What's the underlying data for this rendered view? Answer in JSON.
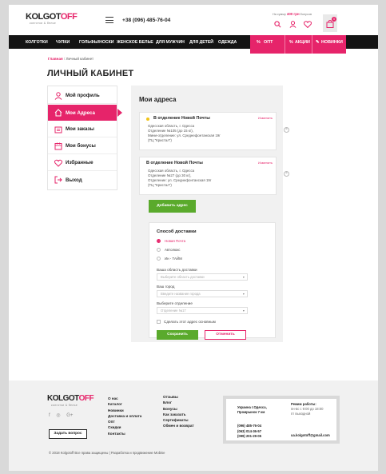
{
  "header": {
    "logo_part1": "KOLGOT",
    "logo_part2": "OFF",
    "logo_sub": "колготки & белье",
    "phone": "+38 (096) 485-76-04",
    "cart_prefix": "На сумму",
    "cart_amount": "400 грн",
    "cart_suffix": "бонусов",
    "cart_count": "0"
  },
  "nav": {
    "items": [
      "КОЛГОТКИ",
      "ЧУЛКИ",
      "ГОЛЬФЫ/НОСКИ",
      "ЖЕНСКОЕ БЕЛЬЕ",
      "ДЛЯ МУЖЧИН",
      "ДЛЯ ДЕТЕЙ",
      "ОДЕЖДА"
    ],
    "opt": "ОПТ",
    "sale": "АКЦИИ",
    "new": "НОВИНКИ"
  },
  "breadcrumb": {
    "home": "Главная",
    "sep": "/",
    "current": "Личный кабинет"
  },
  "page_title": "ЛИЧНЫЙ КАБИНЕТ",
  "sidebar": {
    "items": [
      {
        "label": "Мой профиль"
      },
      {
        "label": "Мои Адреса"
      },
      {
        "label": "Мои заказы"
      },
      {
        "label": "Мои бонусы"
      },
      {
        "label": "Избранные"
      },
      {
        "label": "Выход"
      }
    ]
  },
  "addresses": {
    "title": "Мои адреса",
    "cards": [
      {
        "title": "В отделение Новой Почты",
        "edit": "Изменить",
        "lines": [
          "Одесская область, г. Одесса",
          "Отделение №105 (до 15 кг),",
          "Мини-отделение: ул. Среднефонтанская 19г",
          "(ТЦ \"Кристал\")"
        ]
      },
      {
        "title": "В отделение Новой Почты",
        "edit": "Изменить",
        "lines": [
          "Одесская область, г. Одесса",
          "Отделение №27 (до 30 кг),",
          "Отделение: ул. Среднефонтанская 19г",
          "(ТЦ \"Кристал\")"
        ]
      }
    ],
    "add_button": "Добавить адрес"
  },
  "delivery": {
    "title": "Способ доставки",
    "options": [
      "Новая Почта",
      "Автолюкс",
      "Ин - ТАЙМ"
    ],
    "region_label": "Ваша область доставки",
    "region_placeholder": "Выберите область доставки",
    "city_label": "Ваш город",
    "city_placeholder": "Введите название города",
    "branch_label": "Выберите отделение",
    "branch_placeholder": "Отделение №17",
    "default_label": "Сделать этот адрес основным",
    "save": "Сохранить",
    "cancel": "Отменить"
  },
  "footer": {
    "col1": [
      "О нас",
      "Каталог",
      "Новинки",
      "Доставка и оплата",
      "Опт",
      "Скидки",
      "Контакты"
    ],
    "col2": [
      "Отзывы",
      "Блог",
      "Бонусы",
      "Как заказать",
      "Сертификаты",
      "Обмен и возврат"
    ],
    "ask_button": "Задать вопрос",
    "address": [
      "Украина г.Одесса,",
      "Промрынок 7 км"
    ],
    "hours_title": "Режим работы:",
    "hours": [
      "пн-вс с 9:00 до 18:00",
      "пт выходной"
    ],
    "phones": [
      "(096) 485-76-04",
      "(063) 014-36-57",
      "(099) 201-29-05"
    ],
    "email": "ua.kolgotoff@gmail.com",
    "copyright": "© 2018 Kolgotoff Все права защищены | Разработка и продвижение Mobise"
  },
  "colors": {
    "accent": "#e6246a",
    "green": "#5aaa2c",
    "nav": "#141414"
  }
}
